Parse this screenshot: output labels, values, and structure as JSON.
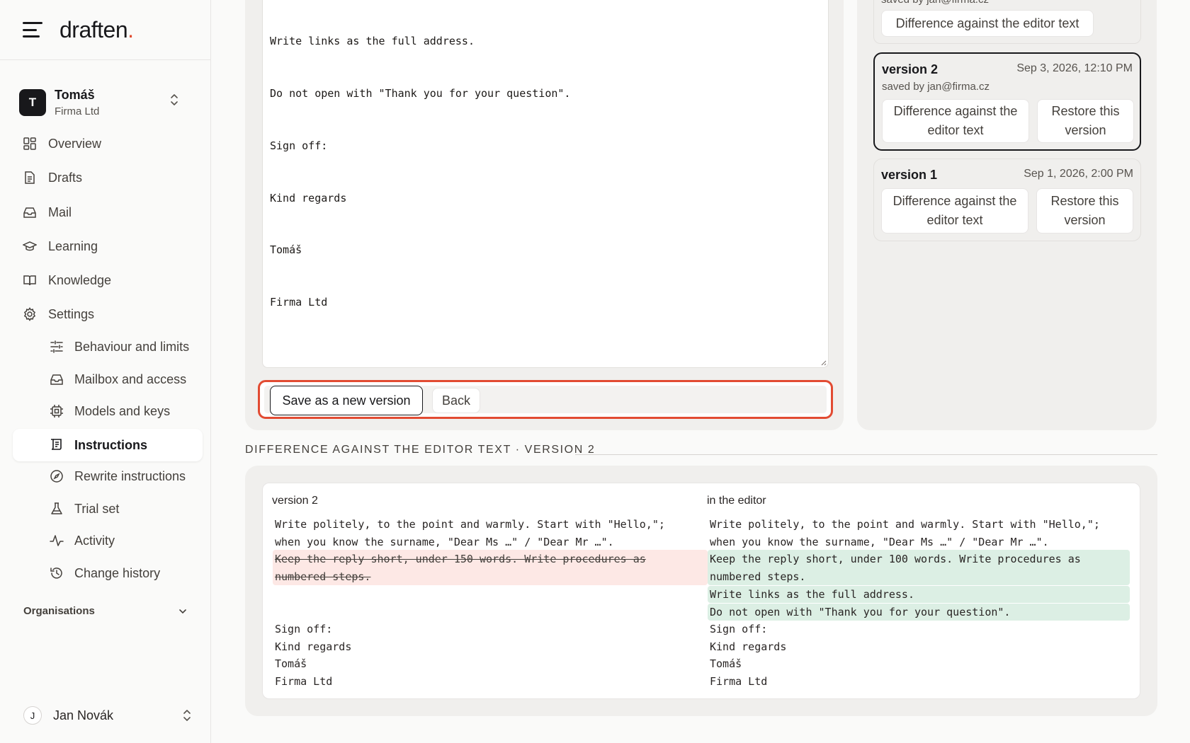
{
  "app": {
    "logo_text": "draften",
    "logo_dot": ".",
    "accent_color": "#e04a2f"
  },
  "org": {
    "avatar_letter": "T",
    "name": "Tomáš",
    "company": "Firma Ltd"
  },
  "nav": {
    "overview": "Overview",
    "drafts": "Drafts",
    "mail": "Mail",
    "learning": "Learning",
    "knowledge": "Knowledge",
    "settings": "Settings",
    "behaviour": "Behaviour and limits",
    "mailbox": "Mailbox and access",
    "models": "Models and keys",
    "instructions": "Instructions",
    "rewrite": "Rewrite instructions",
    "trial": "Trial set",
    "activity": "Activity",
    "history": "Change history",
    "organisations": "Organisations"
  },
  "user": {
    "avatar_letter": "J",
    "name": "Jan Novák"
  },
  "editor": {
    "lines": [
      "Write links as the full address.",
      "Do not open with \"Thank you for your question\".",
      "Sign off:",
      "Kind regards",
      "Tomáš",
      "Firma Ltd"
    ],
    "save_label": "Save as a new version",
    "back_label": "Back"
  },
  "history": {
    "top_saved_by": "saved by jan@firma.cz",
    "top_diff_label": "Difference against the editor text",
    "versions": [
      {
        "title": "version 2",
        "date": "Sep 3, 2026, 12:10 PM",
        "saved_by": "saved by jan@firma.cz",
        "diff_label": "Difference against the editor text",
        "restore_label": "Restore this version"
      },
      {
        "title": "version 1",
        "date": "Sep 1, 2026, 2:00 PM",
        "diff_label": "Difference against the editor text",
        "restore_label": "Restore this version"
      }
    ]
  },
  "diff": {
    "heading": "DIFFERENCE AGAINST THE EDITOR TEXT · VERSION 2",
    "left_title": "version 2",
    "right_title": "in the editor",
    "left": {
      "l1": "Write politely, to the point and warmly. Start with \"Hello,\";",
      "l2": "when you know the surname, \"Dear Ms …\" / \"Dear Mr …\".",
      "del1": "Keep the reply short, under 150 words. Write procedures as",
      "del2": "numbered steps.",
      "s1": "Sign off:",
      "s2": "Kind regards",
      "s3": "Tomáš",
      "s4": "Firma Ltd"
    },
    "right": {
      "l1": "Write politely, to the point and warmly. Start with \"Hello,\";",
      "l2": "when you know the surname, \"Dear Ms …\" / \"Dear Mr …\".",
      "add1": "Keep the reply short, under 100 words. Write procedures as",
      "add2": "numbered steps.",
      "add3": "Write links as the full address.",
      "add4": "Do not open with \"Thank you for your question\".",
      "s1": "Sign off:",
      "s2": "Kind regards",
      "s3": "Tomáš",
      "s4": "Firma Ltd"
    }
  }
}
